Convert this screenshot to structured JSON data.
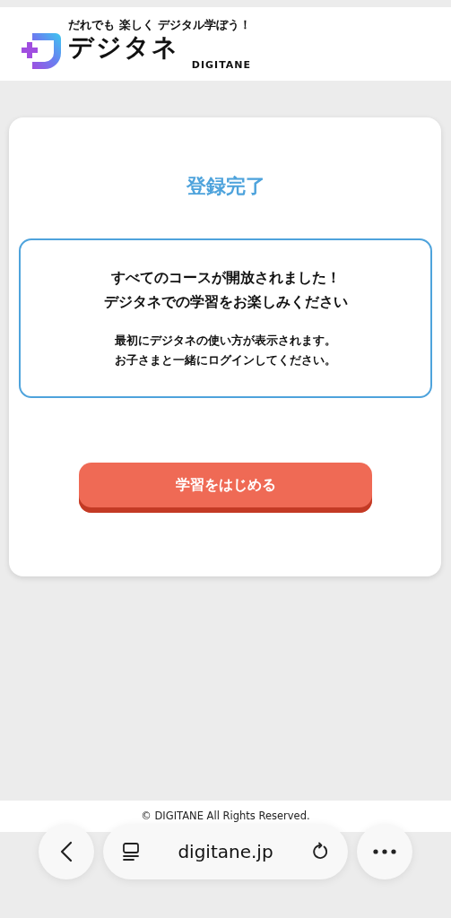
{
  "header": {
    "tagline": "だれでも 楽しく デジタル学ぼう！",
    "logo_text": "デジタネ",
    "logo_subtext": "DIGITANE"
  },
  "card": {
    "title": "登録完了",
    "message_lines": [
      "すべてのコースが開放されました！",
      "デジタネでの学習をお楽しみください"
    ],
    "note_lines": [
      "最初にデジタネの使い方が表示されます。",
      "お子さまと一緒にログインしてください。"
    ],
    "button": "学習をはじめる"
  },
  "footer": {
    "copyright": "© DIGITANE All Rights Reserved."
  },
  "browser_bar": {
    "url": "digitane.jp"
  }
}
